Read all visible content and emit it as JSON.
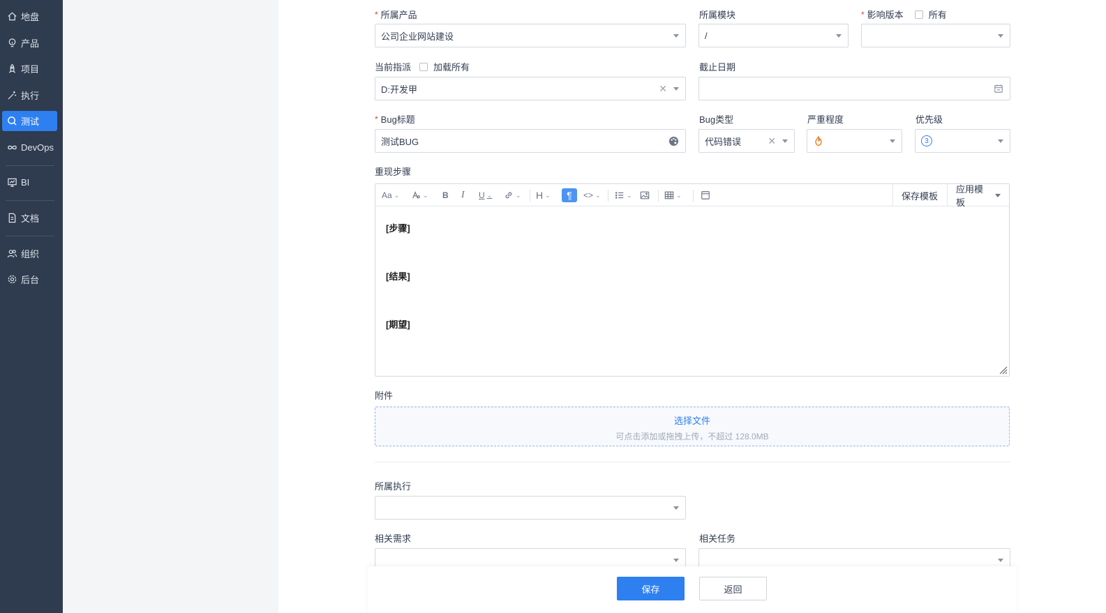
{
  "sidebar": {
    "items": [
      {
        "label": "地盘",
        "icon": "home-icon"
      },
      {
        "label": "产品",
        "icon": "lightbulb-icon"
      },
      {
        "label": "项目",
        "icon": "rocket-icon"
      },
      {
        "label": "执行",
        "icon": "wand-icon"
      },
      {
        "label": "测试",
        "icon": "search-icon",
        "active": true
      },
      {
        "label": "DevOps",
        "icon": "infinity-icon"
      },
      {
        "label": "BI",
        "icon": "chart-board-icon"
      },
      {
        "label": "文档",
        "icon": "document-icon"
      },
      {
        "label": "组织",
        "icon": "people-icon"
      },
      {
        "label": "后台",
        "icon": "gear-icon"
      }
    ]
  },
  "form": {
    "product": {
      "label": "所属产品",
      "value": "公司企业网站建设"
    },
    "module": {
      "label": "所属模块",
      "value": "/"
    },
    "version": {
      "label": "影响版本",
      "all_label": "所有",
      "value": ""
    },
    "assignee": {
      "label": "当前指派",
      "load_all_label": "加载所有",
      "value": "D:开发甲"
    },
    "deadline": {
      "label": "截止日期",
      "value": ""
    },
    "title": {
      "label": "Bug标题",
      "value": "测试BUG"
    },
    "type": {
      "label": "Bug类型",
      "value": "代码错误"
    },
    "severity": {
      "label": "严重程度",
      "value": ""
    },
    "priority": {
      "label": "优先级",
      "value": "3"
    },
    "steps": {
      "label": "重现步骤",
      "lines": [
        "[步骤]",
        "[结果]",
        "[期望]"
      ],
      "save_template": "保存模板",
      "apply_template": "应用模板"
    },
    "attachment": {
      "label": "附件",
      "choose": "选择文件",
      "hint": "可点击添加或拖拽上传，不超过 128.0MB"
    },
    "execution": {
      "label": "所属执行",
      "value": ""
    },
    "story": {
      "label": "相关需求",
      "value": ""
    },
    "task": {
      "label": "相关任务",
      "value": ""
    }
  },
  "footer": {
    "save": "保存",
    "back": "返回"
  },
  "colors": {
    "accent": "#2e7ff0",
    "sidebar": "#2f3b4e",
    "required": "#e5403a",
    "severity": "#f07b1f"
  }
}
